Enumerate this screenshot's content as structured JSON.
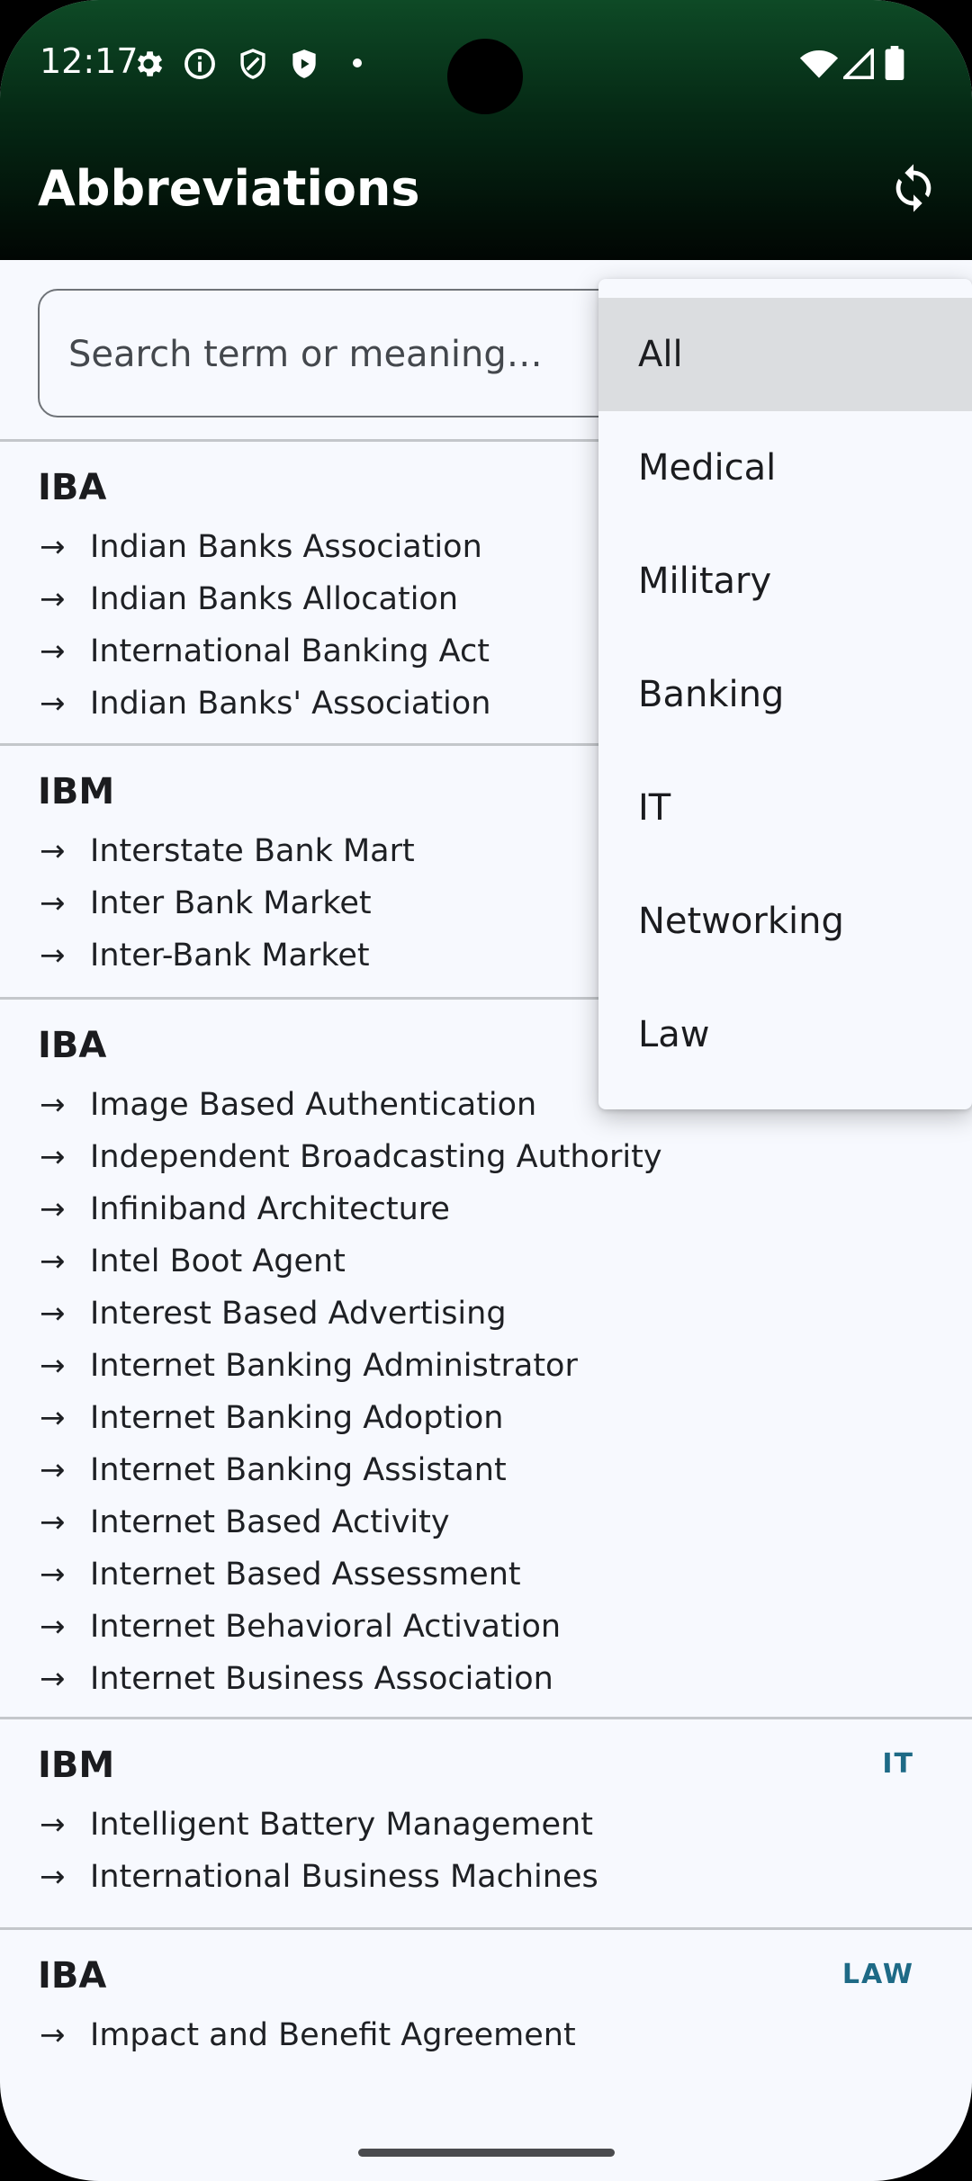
{
  "status": {
    "time": "12:17"
  },
  "app": {
    "title": "Abbreviations"
  },
  "search": {
    "placeholder": "Search term or meaning…",
    "value": ""
  },
  "dropdown": {
    "selected": "All",
    "options": [
      "All",
      "Medical",
      "Military",
      "Banking",
      "IT",
      "Networking",
      "Law"
    ]
  },
  "results": [
    {
      "abbr": "IBA",
      "category": "",
      "meanings": [
        "Indian Banks Association",
        "Indian Banks Allocation",
        "International Banking Act",
        "Indian Banks' Association"
      ]
    },
    {
      "abbr": "IBM",
      "category": "",
      "meanings": [
        "Interstate Bank Mart",
        "Inter Bank Market",
        "Inter-Bank Market"
      ]
    },
    {
      "abbr": "IBA",
      "category": "",
      "meanings": [
        "Image Based Authentication",
        "Independent Broadcasting Authority",
        "Infiniband Architecture",
        "Intel Boot Agent",
        "Interest Based Advertising",
        "Internet Banking Administrator",
        "Internet Banking Adoption",
        "Internet Banking Assistant",
        "Internet Based Activity",
        "Internet Based Assessment",
        "Internet Behavioral Activation",
        "Internet Business Association"
      ]
    },
    {
      "abbr": "IBM",
      "category": "IT",
      "meanings": [
        "Intelligent Battery Management",
        "International Business Machines"
      ]
    },
    {
      "abbr": "IBA",
      "category": "LAW",
      "meanings": [
        "Impact and Benefit Agreement"
      ]
    }
  ],
  "icons": {
    "settings": "gear-icon",
    "info": "info-icon",
    "shield": "shield-outline-icon",
    "play-protect": "play-shield-icon",
    "refresh": "sync-icon",
    "arrow": "→"
  }
}
